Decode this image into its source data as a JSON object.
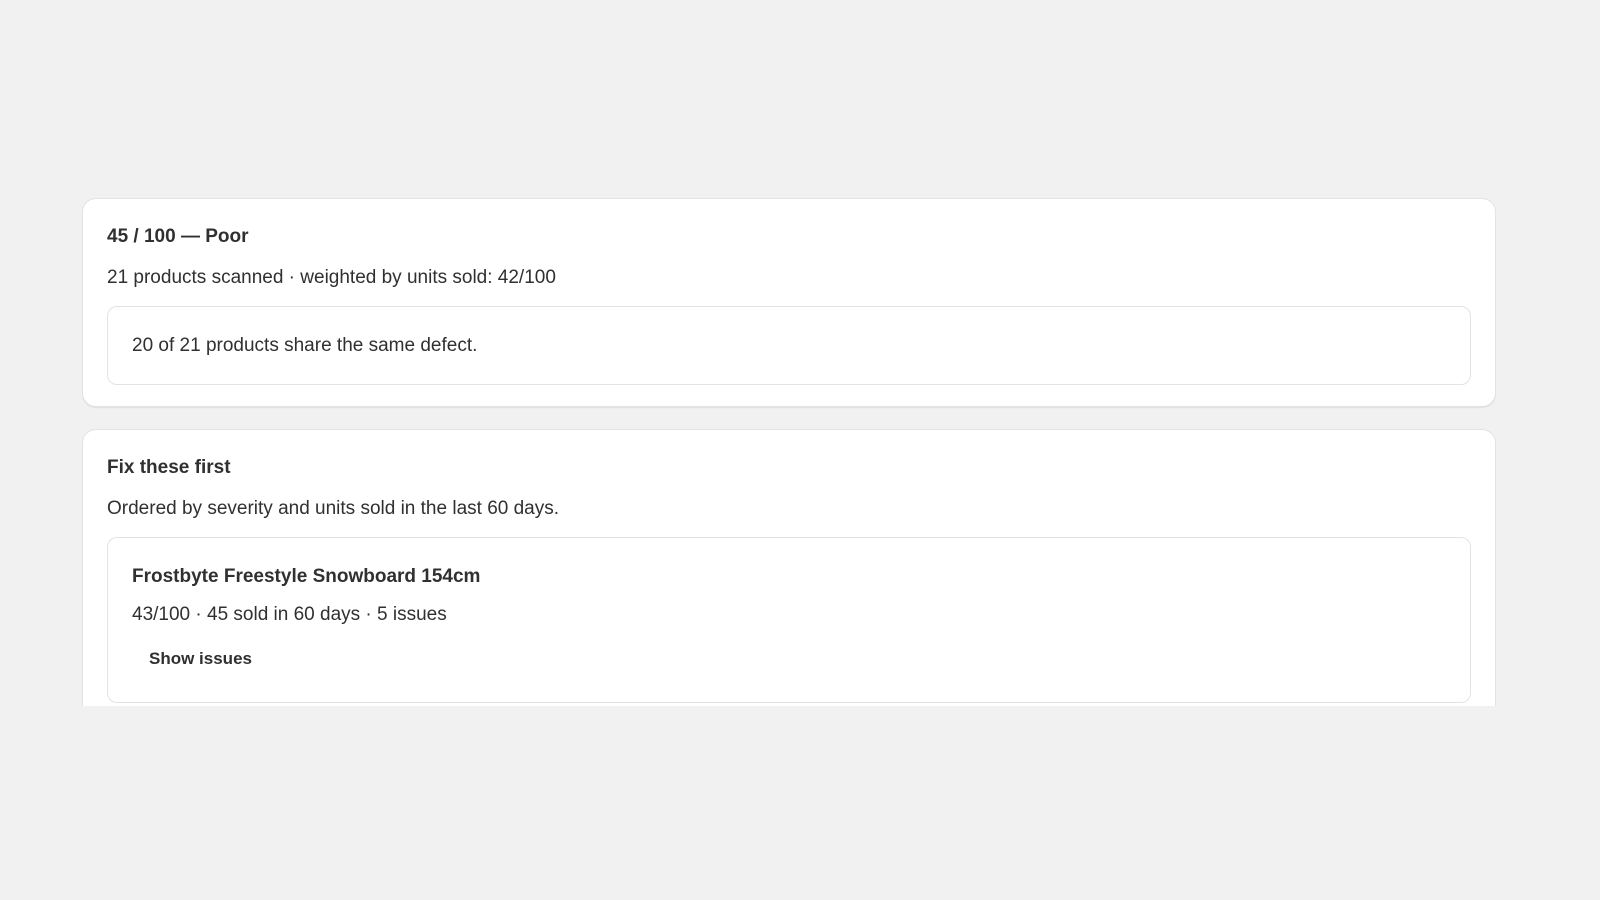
{
  "score_card": {
    "title": "45 / 100 — Poor",
    "subtitle": "21 products scanned · weighted by units sold: 42/100",
    "defect_note": "20 of 21 products share the same defect."
  },
  "fix_card": {
    "title": "Fix these first",
    "subtitle": "Ordered by severity and units sold in the last 60 days.",
    "products": [
      {
        "name": "Frostbyte Freestyle Snowboard 154cm",
        "meta": "43/100 · 45 sold in 60 days · 5 issues",
        "action_label": "Show issues"
      }
    ]
  },
  "colors": {
    "page_background": "#f1f1f1",
    "card_background": "#ffffff",
    "border": "#e3e3e3",
    "text": "#303030"
  }
}
